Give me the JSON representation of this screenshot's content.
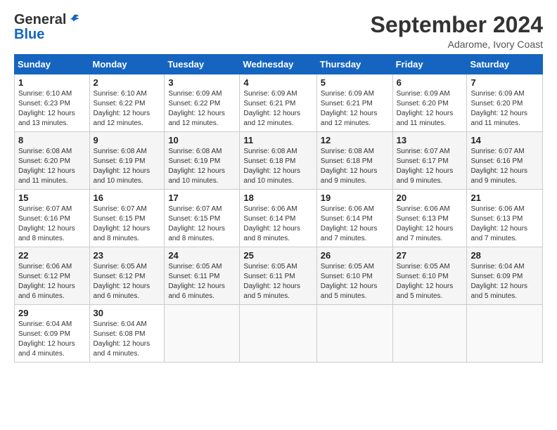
{
  "logo": {
    "general": "General",
    "blue": "Blue"
  },
  "header": {
    "month": "September 2024",
    "location": "Adarome, Ivory Coast"
  },
  "weekdays": [
    "Sunday",
    "Monday",
    "Tuesday",
    "Wednesday",
    "Thursday",
    "Friday",
    "Saturday"
  ],
  "weeks": [
    [
      {
        "day": "1",
        "sunrise": "6:10 AM",
        "sunset": "6:23 PM",
        "daylight": "12 hours and 13 minutes."
      },
      {
        "day": "2",
        "sunrise": "6:10 AM",
        "sunset": "6:22 PM",
        "daylight": "12 hours and 12 minutes."
      },
      {
        "day": "3",
        "sunrise": "6:09 AM",
        "sunset": "6:22 PM",
        "daylight": "12 hours and 12 minutes."
      },
      {
        "day": "4",
        "sunrise": "6:09 AM",
        "sunset": "6:21 PM",
        "daylight": "12 hours and 12 minutes."
      },
      {
        "day": "5",
        "sunrise": "6:09 AM",
        "sunset": "6:21 PM",
        "daylight": "12 hours and 12 minutes."
      },
      {
        "day": "6",
        "sunrise": "6:09 AM",
        "sunset": "6:20 PM",
        "daylight": "12 hours and 11 minutes."
      },
      {
        "day": "7",
        "sunrise": "6:09 AM",
        "sunset": "6:20 PM",
        "daylight": "12 hours and 11 minutes."
      }
    ],
    [
      {
        "day": "8",
        "sunrise": "6:08 AM",
        "sunset": "6:20 PM",
        "daylight": "12 hours and 11 minutes."
      },
      {
        "day": "9",
        "sunrise": "6:08 AM",
        "sunset": "6:19 PM",
        "daylight": "12 hours and 10 minutes."
      },
      {
        "day": "10",
        "sunrise": "6:08 AM",
        "sunset": "6:19 PM",
        "daylight": "12 hours and 10 minutes."
      },
      {
        "day": "11",
        "sunrise": "6:08 AM",
        "sunset": "6:18 PM",
        "daylight": "12 hours and 10 minutes."
      },
      {
        "day": "12",
        "sunrise": "6:08 AM",
        "sunset": "6:18 PM",
        "daylight": "12 hours and 9 minutes."
      },
      {
        "day": "13",
        "sunrise": "6:07 AM",
        "sunset": "6:17 PM",
        "daylight": "12 hours and 9 minutes."
      },
      {
        "day": "14",
        "sunrise": "6:07 AM",
        "sunset": "6:16 PM",
        "daylight": "12 hours and 9 minutes."
      }
    ],
    [
      {
        "day": "15",
        "sunrise": "6:07 AM",
        "sunset": "6:16 PM",
        "daylight": "12 hours and 8 minutes."
      },
      {
        "day": "16",
        "sunrise": "6:07 AM",
        "sunset": "6:15 PM",
        "daylight": "12 hours and 8 minutes."
      },
      {
        "day": "17",
        "sunrise": "6:07 AM",
        "sunset": "6:15 PM",
        "daylight": "12 hours and 8 minutes."
      },
      {
        "day": "18",
        "sunrise": "6:06 AM",
        "sunset": "6:14 PM",
        "daylight": "12 hours and 8 minutes."
      },
      {
        "day": "19",
        "sunrise": "6:06 AM",
        "sunset": "6:14 PM",
        "daylight": "12 hours and 7 minutes."
      },
      {
        "day": "20",
        "sunrise": "6:06 AM",
        "sunset": "6:13 PM",
        "daylight": "12 hours and 7 minutes."
      },
      {
        "day": "21",
        "sunrise": "6:06 AM",
        "sunset": "6:13 PM",
        "daylight": "12 hours and 7 minutes."
      }
    ],
    [
      {
        "day": "22",
        "sunrise": "6:06 AM",
        "sunset": "6:12 PM",
        "daylight": "12 hours and 6 minutes."
      },
      {
        "day": "23",
        "sunrise": "6:05 AM",
        "sunset": "6:12 PM",
        "daylight": "12 hours and 6 minutes."
      },
      {
        "day": "24",
        "sunrise": "6:05 AM",
        "sunset": "6:11 PM",
        "daylight": "12 hours and 6 minutes."
      },
      {
        "day": "25",
        "sunrise": "6:05 AM",
        "sunset": "6:11 PM",
        "daylight": "12 hours and 5 minutes."
      },
      {
        "day": "26",
        "sunrise": "6:05 AM",
        "sunset": "6:10 PM",
        "daylight": "12 hours and 5 minutes."
      },
      {
        "day": "27",
        "sunrise": "6:05 AM",
        "sunset": "6:10 PM",
        "daylight": "12 hours and 5 minutes."
      },
      {
        "day": "28",
        "sunrise": "6:04 AM",
        "sunset": "6:09 PM",
        "daylight": "12 hours and 5 minutes."
      }
    ],
    [
      {
        "day": "29",
        "sunrise": "6:04 AM",
        "sunset": "6:09 PM",
        "daylight": "12 hours and 4 minutes."
      },
      {
        "day": "30",
        "sunrise": "6:04 AM",
        "sunset": "6:08 PM",
        "daylight": "12 hours and 4 minutes."
      },
      null,
      null,
      null,
      null,
      null
    ]
  ]
}
